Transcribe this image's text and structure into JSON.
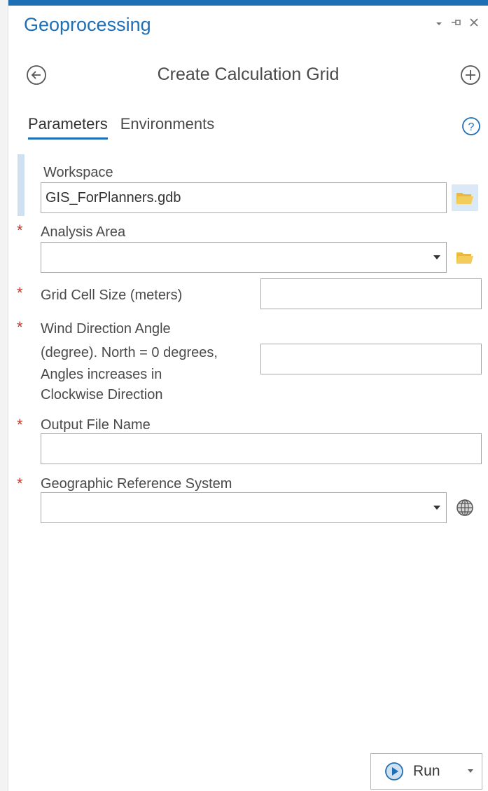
{
  "pane": {
    "title": "Geoprocessing",
    "controls": {
      "dropdown_icon": "caret-down-icon",
      "pin_icon": "pin-icon",
      "close_icon": "close-icon"
    }
  },
  "tool": {
    "title": "Create Calculation Grid",
    "back_icon": "back-arrow-circle-icon",
    "add_icon": "add-circle-icon"
  },
  "tabs": [
    {
      "label": "Parameters",
      "active": true
    },
    {
      "label": "Environments",
      "active": false
    }
  ],
  "help_icon": "help-icon",
  "parameters": {
    "workspace": {
      "label": "Workspace",
      "value": "GIS_ForPlanners.gdb",
      "required": false
    },
    "analysis_area": {
      "label": "Analysis Area",
      "value": "",
      "required": true
    },
    "grid_cell_size": {
      "label": "Grid Cell Size (meters)",
      "value": "",
      "required": true
    },
    "wind_direction": {
      "label_lines": [
        "Wind Direction Angle",
        "(degree). North = 0 degrees,",
        "Angles increases in",
        "Clockwise Direction"
      ],
      "value": "",
      "required": true
    },
    "output_file": {
      "label": "Output File Name",
      "value": "",
      "required": true
    },
    "geo_ref": {
      "label": "Geographic Reference System",
      "value": "",
      "required": true
    }
  },
  "required_marker": "*",
  "run": {
    "label": "Run"
  },
  "colors": {
    "accent": "#1f6fb4",
    "required": "#c0392b",
    "folder": "#e8b93c"
  }
}
